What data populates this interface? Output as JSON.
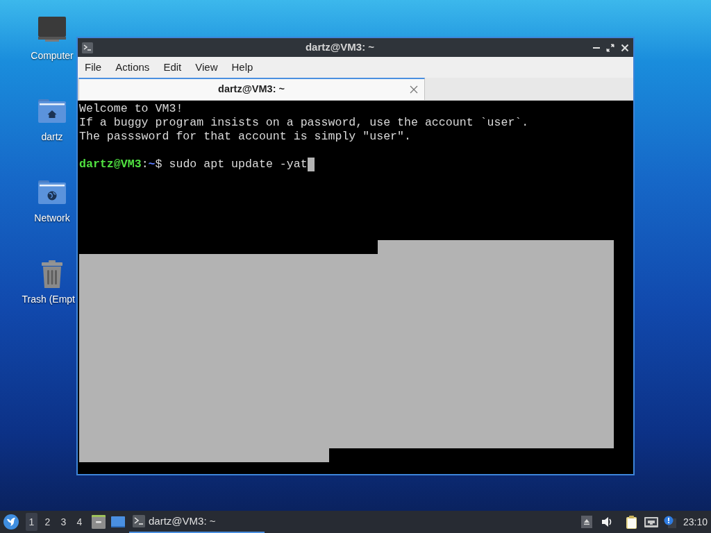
{
  "desktop_icons": [
    {
      "label": "Computer",
      "kind": "computer"
    },
    {
      "label": "dartz",
      "kind": "home"
    },
    {
      "label": "Network",
      "kind": "network"
    },
    {
      "label": "Trash (Empt",
      "kind": "trash"
    }
  ],
  "window": {
    "title": "dartz@VM3: ~",
    "menu": [
      "File",
      "Actions",
      "Edit",
      "View",
      "Help"
    ],
    "tabs": [
      {
        "label": "dartz@VM3: ~",
        "selected": true
      }
    ],
    "terminal": {
      "output": [
        "Welcome to VM3!",
        "If a buggy program insists on a password, use the account `user`.",
        "The passsword for that account is simply \"user\"."
      ],
      "prompt": {
        "user": "dartz@VM3",
        "separator": ":",
        "path": "~",
        "symbol": "$",
        "command": "sudo apt update -yat"
      }
    }
  },
  "taskbar": {
    "workspaces": [
      {
        "label": "1",
        "selected": true
      },
      {
        "label": "2",
        "selected": false
      },
      {
        "label": "3",
        "selected": false
      },
      {
        "label": "4",
        "selected": false
      }
    ],
    "tasks": [
      {
        "label": "dartz@VM3: ~",
        "selected": true
      }
    ],
    "clock": "23:10"
  }
}
